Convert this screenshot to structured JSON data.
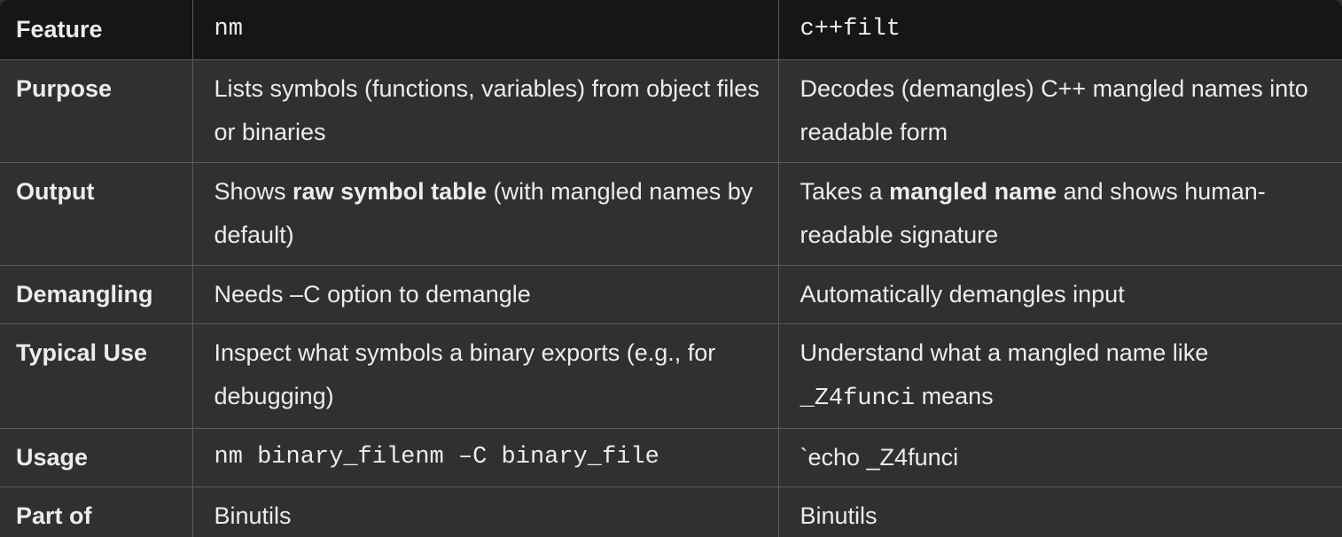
{
  "headers": [
    "Feature",
    "nm",
    "c++filt"
  ],
  "rows": {
    "purpose": {
      "feature": "Purpose",
      "nm": "Lists symbols (functions, variables) from object files or binaries",
      "cppfilt": "Decodes (demangles) C++ mangled names into readable form"
    },
    "output": {
      "feature": "Output",
      "nm_pre": "Shows ",
      "nm_bold": "raw symbol table",
      "nm_post": " (with mangled names by default)",
      "cppfilt_pre": "Takes a ",
      "cppfilt_bold": "mangled name",
      "cppfilt_post": " and shows human-readable signature"
    },
    "demangling": {
      "feature": "Demangling",
      "nm": "Needs –C option to demangle",
      "cppfilt": "Automatically demangles input"
    },
    "typical_use": {
      "feature": "Typical Use",
      "nm": "Inspect what symbols a binary exports (e.g., for debugging)",
      "cppfilt_pre": "Understand what a mangled name like ",
      "cppfilt_code": "_Z4funci",
      "cppfilt_post": " means"
    },
    "usage": {
      "feature": "Usage",
      "nm": "nm binary_filenm –C binary_file",
      "cppfilt": "`echo _Z4funci"
    },
    "part_of": {
      "feature": "Part of",
      "nm": "Binutils",
      "cppfilt": "Binutils"
    }
  }
}
